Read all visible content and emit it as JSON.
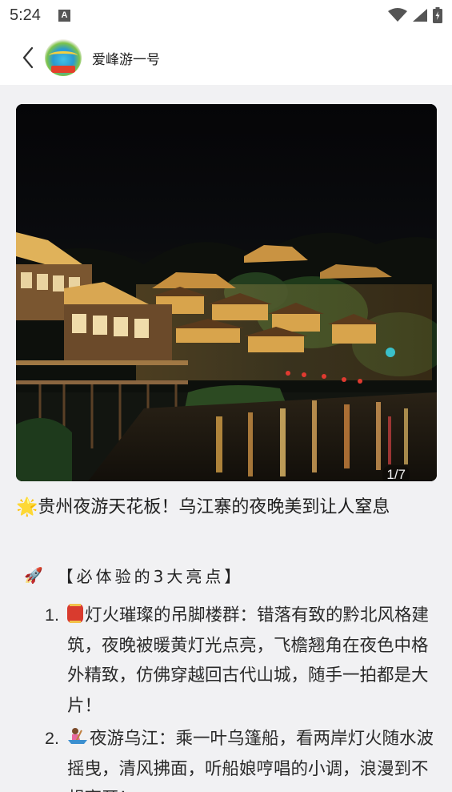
{
  "status_bar": {
    "time": "5:24",
    "notification_icon": "A"
  },
  "header": {
    "account_name": "爱峰游一号"
  },
  "gallery": {
    "indicator": "1/7"
  },
  "post": {
    "title_emoji": "🌟",
    "title": "贵州夜游天花板！乌江寨的夜晚美到让人窒息",
    "section_emoji": "🚀",
    "section_heading": "【必体验的3大亮点】",
    "items": [
      {
        "num": "1.",
        "emoji": "🏮",
        "text": "灯火璀璨的吊脚楼群：错落有致的黔北风格建筑，夜晚被暖黄灯光点亮，飞檐翘角在夜色中格外精致，仿佛穿越回古代山城，随手一拍都是大片！"
      },
      {
        "num": "2.",
        "emoji": "🚣",
        "text": "夜游乌江：乘一叶乌篷船，看两岸灯火随水波摇曳，清风拂面，听船娘哼唱的小调，浪漫到不想离开！"
      }
    ]
  },
  "colors": {
    "header_bg": "#ffffff",
    "page_bg": "#f1f1f3",
    "text": "#222222"
  }
}
